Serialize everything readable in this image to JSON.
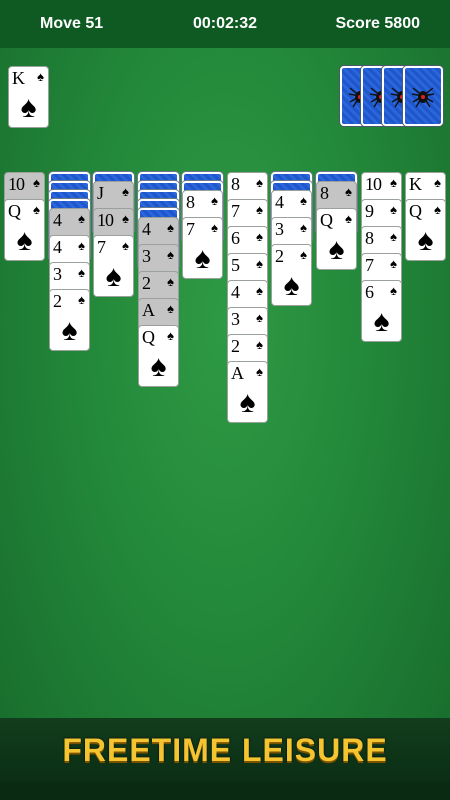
{
  "header": {
    "moves": "Move 51",
    "timer": "00:02:32",
    "score": "Score 5800"
  },
  "foundation": [
    {
      "rank": "K",
      "suit": "♠"
    }
  ],
  "stock": {
    "remaining_deals": 4
  },
  "tableau": [
    {
      "face_down": 0,
      "cards": [
        {
          "rank": "10",
          "suit": "♠",
          "dim": true
        },
        {
          "rank": "Q",
          "suit": "♠"
        }
      ]
    },
    {
      "face_down": 4,
      "cards": [
        {
          "rank": "4",
          "suit": "♠",
          "dim": true
        },
        {
          "rank": "4",
          "suit": "♠"
        },
        {
          "rank": "3",
          "suit": "♠"
        },
        {
          "rank": "2",
          "suit": "♠"
        }
      ]
    },
    {
      "face_down": 1,
      "cards": [
        {
          "rank": "J",
          "suit": "♠",
          "dim": true
        },
        {
          "rank": "10",
          "suit": "♠",
          "dim": true
        },
        {
          "rank": "7",
          "suit": "♠"
        }
      ]
    },
    {
      "face_down": 5,
      "cards": [
        {
          "rank": "4",
          "suit": "♠",
          "dim": true
        },
        {
          "rank": "3",
          "suit": "♠",
          "dim": true
        },
        {
          "rank": "2",
          "suit": "♠",
          "dim": true
        },
        {
          "rank": "A",
          "suit": "♠",
          "dim": true
        },
        {
          "rank": "Q",
          "suit": "♠"
        }
      ]
    },
    {
      "face_down": 2,
      "cards": [
        {
          "rank": "8",
          "suit": "♠"
        },
        {
          "rank": "7",
          "suit": "♠"
        }
      ]
    },
    {
      "face_down": 0,
      "cards": [
        {
          "rank": "8",
          "suit": "♠"
        },
        {
          "rank": "7",
          "suit": "♠"
        },
        {
          "rank": "6",
          "suit": "♠"
        },
        {
          "rank": "5",
          "suit": "♠"
        },
        {
          "rank": "4",
          "suit": "♠"
        },
        {
          "rank": "3",
          "suit": "♠"
        },
        {
          "rank": "2",
          "suit": "♠"
        },
        {
          "rank": "A",
          "suit": "♠"
        }
      ]
    },
    {
      "face_down": 2,
      "cards": [
        {
          "rank": "4",
          "suit": "♠"
        },
        {
          "rank": "3",
          "suit": "♠"
        },
        {
          "rank": "2",
          "suit": "♠"
        }
      ]
    },
    {
      "face_down": 1,
      "cards": [
        {
          "rank": "8",
          "suit": "♠",
          "dim": true
        },
        {
          "rank": "Q",
          "suit": "♠"
        }
      ]
    },
    {
      "face_down": 0,
      "cards": [
        {
          "rank": "10",
          "suit": "♠"
        },
        {
          "rank": "9",
          "suit": "♠"
        },
        {
          "rank": "8",
          "suit": "♠"
        },
        {
          "rank": "7",
          "suit": "♠"
        },
        {
          "rank": "6",
          "suit": "♠"
        }
      ]
    },
    {
      "face_down": 0,
      "cards": [
        {
          "rank": "K",
          "suit": "♠"
        },
        {
          "rank": "Q",
          "suit": "♠"
        }
      ]
    }
  ],
  "banner": {
    "text": "FREETIME LEISURE"
  },
  "colors": {
    "felt": "#23883a",
    "header": "#0f5a22",
    "card_back": "#2a66dd",
    "banner_text": "#f4c431"
  }
}
